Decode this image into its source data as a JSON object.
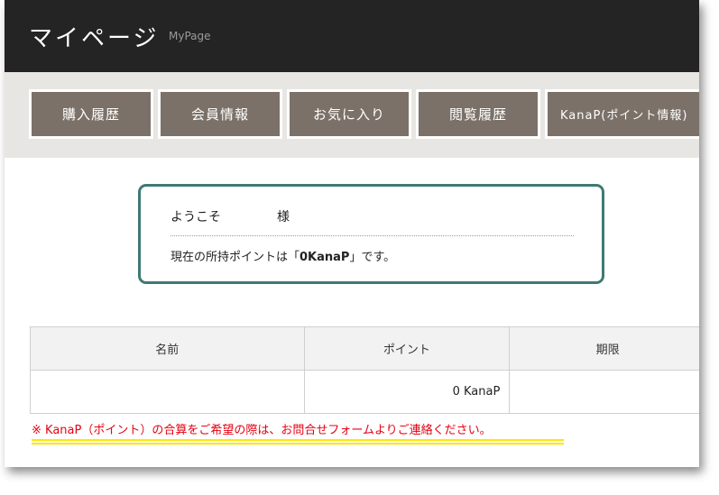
{
  "header": {
    "title": "マイページ",
    "subtitle": "MyPage"
  },
  "nav": [
    {
      "label": "購入履歴"
    },
    {
      "label": "会員情報"
    },
    {
      "label": "お気に入り"
    },
    {
      "label": "閲覧履歴"
    },
    {
      "label": "KanaP(ポイント情報)"
    }
  ],
  "welcome": {
    "greeting_prefix": "ようこそ",
    "greeting_suffix": "様",
    "points_prefix": "現在の所持ポイントは「",
    "points_value": "0KanaP",
    "points_suffix": "」です。"
  },
  "points_table": {
    "headers": [
      "名前",
      "ポイント",
      "期限"
    ],
    "rows": [
      {
        "name": "",
        "points": "0 KanaP",
        "expiry": ""
      }
    ]
  },
  "notice": "※ KanaP（ポイント）の合算をご希望の際は、お問合せフォームよりご連絡ください。",
  "colors": {
    "header_bg": "#242424",
    "nav_bg": "#7b7168",
    "box_border": "#3f7a73",
    "notice": "#e60012",
    "highlight": "#ffe600"
  }
}
